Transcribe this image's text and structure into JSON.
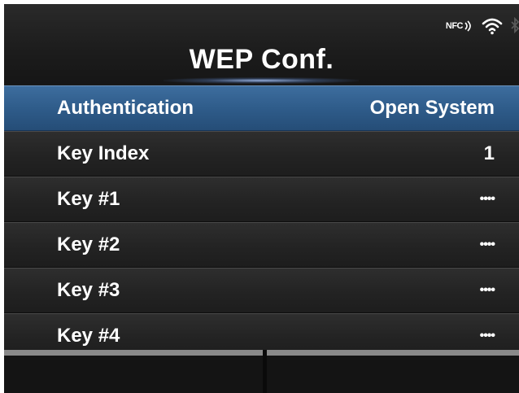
{
  "header": {
    "title": "WEP Conf.",
    "status": {
      "nfc_label": "NFC",
      "icons": [
        "nfc-icon",
        "wifi-icon",
        "bluetooth-icon"
      ]
    }
  },
  "menu": {
    "selected_index": 0,
    "items": [
      {
        "label": "Authentication",
        "value": "Open System"
      },
      {
        "label": "Key Index",
        "value": "1"
      },
      {
        "label": "Key #1",
        "value": "••••"
      },
      {
        "label": "Key #2",
        "value": "••••"
      },
      {
        "label": "Key #3",
        "value": "••••"
      },
      {
        "label": "Key #4",
        "value": "••••"
      }
    ]
  },
  "function_bar": {
    "left_label": "",
    "right_label": ""
  },
  "colors": {
    "background": "#181818",
    "selection": "#2f5c8a",
    "text": "#ffffff",
    "function_key": "#8a8a8a"
  }
}
